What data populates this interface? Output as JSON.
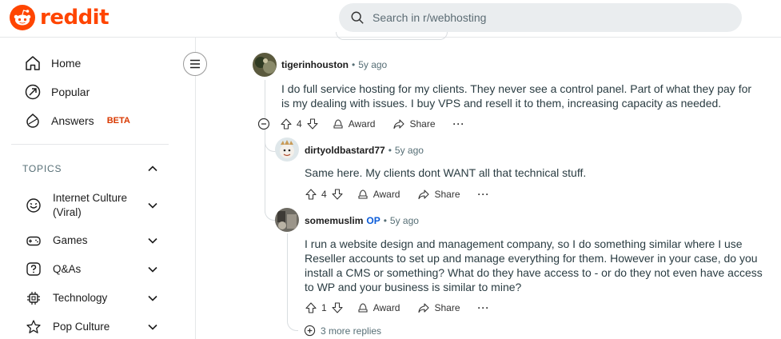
{
  "colors": {
    "brand": "#ff4500",
    "op": "#0a5bd8",
    "beta": "#d93900"
  },
  "header": {
    "brand": "reddit",
    "search_placeholder": "Search in r/webhosting"
  },
  "sidebar": {
    "nav": [
      {
        "label": "Home",
        "icon": "home-icon"
      },
      {
        "label": "Popular",
        "icon": "popular-icon"
      },
      {
        "label": "Answers",
        "icon": "answers-icon",
        "badge": "BETA"
      }
    ],
    "topics_heading": "TOPICS",
    "topics": [
      {
        "label": "Internet Culture (Viral)",
        "icon": "smile-icon"
      },
      {
        "label": "Games",
        "icon": "gamepad-icon"
      },
      {
        "label": "Q&As",
        "icon": "question-icon"
      },
      {
        "label": "Technology",
        "icon": "chip-icon"
      },
      {
        "label": "Pop Culture",
        "icon": "star-icon"
      }
    ]
  },
  "comments": [
    {
      "user": "tigerinhouston",
      "age": "5y ago",
      "text": "I do full service hosting for my clients. They never see a control panel. Part of what they pay for is my dealing with issues. I buy VPS and resell it to them, increasing capacity as needed.",
      "votes": "4",
      "award": "Award",
      "share": "Share",
      "more": "···"
    },
    {
      "user": "dirtyoldbastard77",
      "age": "5y ago",
      "text": "Same here. My clients dont WANT all that technical stuff.",
      "votes": "4",
      "award": "Award",
      "share": "Share",
      "more": "···"
    },
    {
      "user": "somemuslim",
      "op": "OP",
      "age": "5y ago",
      "text": "I run a website design and management company, so I do something similar where I use Reseller accounts to set up and manage everything for them. However in your case, do you install a CMS or something? What do they have access to - or do they not even have access to WP and your business is similar to mine?",
      "votes": "1",
      "award": "Award",
      "share": "Share",
      "more": "···"
    }
  ],
  "more_replies": "3 more replies"
}
